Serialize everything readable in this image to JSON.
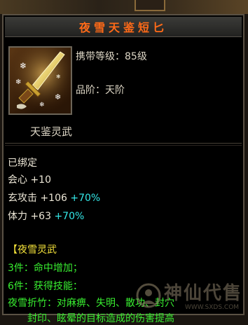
{
  "window": {
    "title": "夜雪天鉴短匕"
  },
  "item": {
    "level_label": "携带等级：",
    "level_value": "85级",
    "rank_label": "品阶：",
    "rank_value": "天阶",
    "subtitle": "天鉴灵武",
    "icon": "dagger-icon"
  },
  "stats": {
    "bound": "已绑定",
    "crit_label": "会心",
    "crit_value": "+10",
    "xuan_label": "玄攻击",
    "xuan_value": "+106",
    "xuan_bonus": "+70%",
    "hp_label": "体力",
    "hp_value": "+63",
    "hp_bonus": "+70%"
  },
  "set": {
    "name": "【夜雪灵武",
    "piece3": "3件：命中增加；",
    "piece6": "6件：获得技能：",
    "skill": "夜雪折竹：对麻痹、失明、散功、封穴",
    "skill_cont": "封印、眩晕的目标造成的伤害提高"
  },
  "watermark": {
    "text": "神仙代售",
    "url": "WWW.SXDS.COM"
  },
  "colors": {
    "title": "#ff6a18",
    "set_name": "#f4e23a",
    "set_text": "#38ee30",
    "bonus": "#34e8e8"
  }
}
